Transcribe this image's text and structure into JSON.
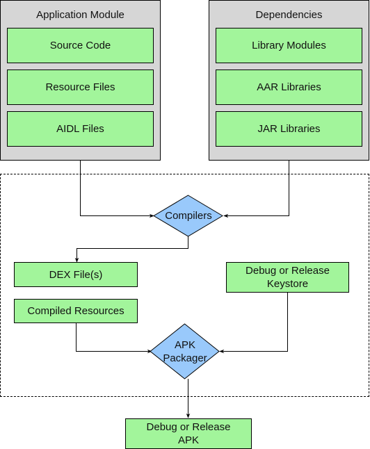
{
  "groups": {
    "application_module": {
      "title": "Application Module",
      "items": [
        "Source Code",
        "Resource Files",
        "AIDL Files"
      ]
    },
    "dependencies": {
      "title": "Dependencies",
      "items": [
        "Library Modules",
        "AAR Libraries",
        "JAR Libraries"
      ]
    }
  },
  "process_nodes": {
    "compilers": "Compilers",
    "apk_packager_line1": "APK",
    "apk_packager_line2": "Packager"
  },
  "intermediate_nodes": {
    "dex_files": "DEX File(s)",
    "compiled_resources": "Compiled Resources",
    "keystore_line1": "Debug or Release",
    "keystore_line2": "Keystore"
  },
  "output_node": {
    "line1": "Debug or Release",
    "line2": "APK"
  },
  "colors": {
    "group_fill": "#d6d6d6",
    "node_fill": "#a2f59b",
    "decision_fill": "#99c9fb"
  }
}
